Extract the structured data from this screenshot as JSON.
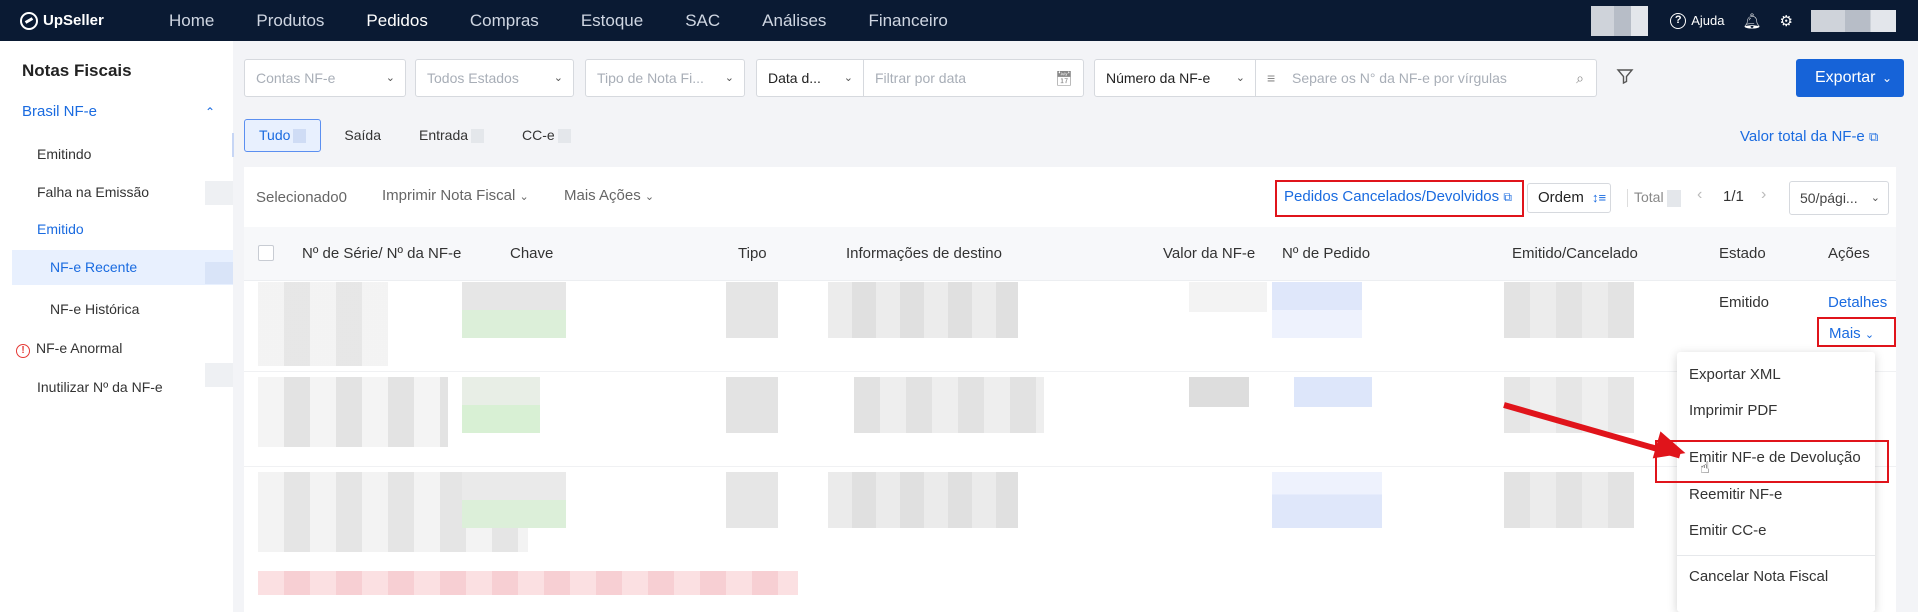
{
  "app": {
    "logo_text": "UpSeller"
  },
  "nav": [
    "Home",
    "Produtos",
    "Pedidos",
    "Compras",
    "Estoque",
    "SAC",
    "Análises",
    "Financeiro"
  ],
  "nav_active": "Pedidos",
  "top_right": {
    "help_label": "Ajuda",
    "help_icon": "question-circle-icon",
    "bell_icon": "bell-icon",
    "gear_icon": "gear-icon"
  },
  "sidebar": {
    "title": "Notas Fiscais",
    "group": "Brasil NF-e",
    "items": [
      "Emitindo",
      "Falha na Emissão",
      "Emitido",
      "NF-e Recente",
      "NF-e Histórica",
      "NF-e Anormal",
      "Inutilizar Nº da NF-e"
    ]
  },
  "filters": {
    "contas": "Contas NF-e",
    "estados": "Todos Estados",
    "tipo": "Tipo de Nota Fi...",
    "data_tipo": "Data d...",
    "data_placeholder": "Filtrar por data",
    "numero_tipo": "Número da NF-e",
    "numero_placeholder": "Separe os N° da NF-e por vírgulas",
    "export_label": "Exportar"
  },
  "tabs": [
    "Tudo",
    "Saída",
    "Entrada",
    "CC-e"
  ],
  "tab_active": "Tudo",
  "total_link": "Valor total da NF-e",
  "toolbar": {
    "selected_label": "Selecionado",
    "selected_count": "0",
    "print_label": "Imprimir Nota Fiscal",
    "more_actions_label": "Mais Ações",
    "cancelled_link": "Pedidos Cancelados/Devolvidos",
    "order_label": "Ordem",
    "total_label": "Total",
    "page_info": "1/1",
    "per_page": "50/pági..."
  },
  "table": {
    "headers": [
      "Nº de Série/ Nº da NF-e",
      "Chave",
      "Tipo",
      "Informações de destino",
      "Valor da NF-e",
      "Nº de Pedido",
      "Emitido/Cancelado",
      "Estado",
      "Ações"
    ],
    "row1_estado": "Emitido",
    "row1_detalhes": "Detalhes",
    "row1_mais": "Mais"
  },
  "dropdown": [
    "Exportar XML",
    "Imprimir PDF",
    "Emitir NF-e de Devolução",
    "Reemitir NF-e",
    "Emitir CC-e",
    "Cancelar Nota Fiscal"
  ],
  "colors": {
    "topbar": "#0a1a33",
    "primary": "#1663d8",
    "link": "#1a6be0",
    "highlight": "#e0141b"
  }
}
